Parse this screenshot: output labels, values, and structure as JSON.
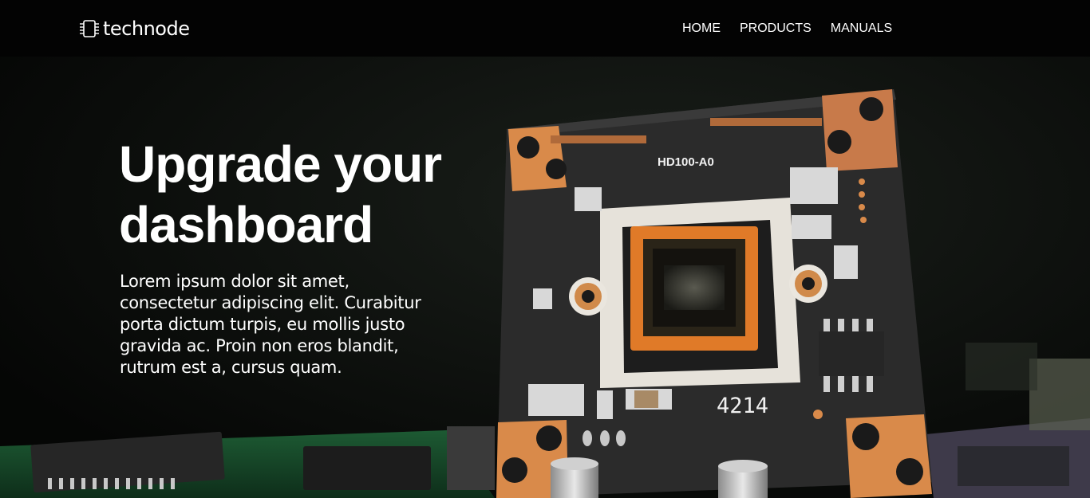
{
  "brand": {
    "name": "technode",
    "icon": "chip-icon"
  },
  "nav": {
    "items": [
      {
        "label": "HOME"
      },
      {
        "label": "PRODUCTS"
      },
      {
        "label": "MANUALS"
      }
    ]
  },
  "hero": {
    "title_line1": "Upgrade your",
    "title_line2": "dashboard",
    "body": "Lorem ipsum dolor sit amet, consectetur adipiscing elit. Curabitur porta dictum turpis, eu mollis justo gravida ac. Proin non eros blandit, rutrum est a, cursus quam.",
    "board_label": "HD100-A0",
    "board_number": "4214"
  },
  "colors": {
    "nav_bg": "#030303",
    "text": "#ffffff",
    "pcb_black": "#2a2a2a",
    "copper": "#d98a4a",
    "pcb_green": "#1f6b3a"
  }
}
